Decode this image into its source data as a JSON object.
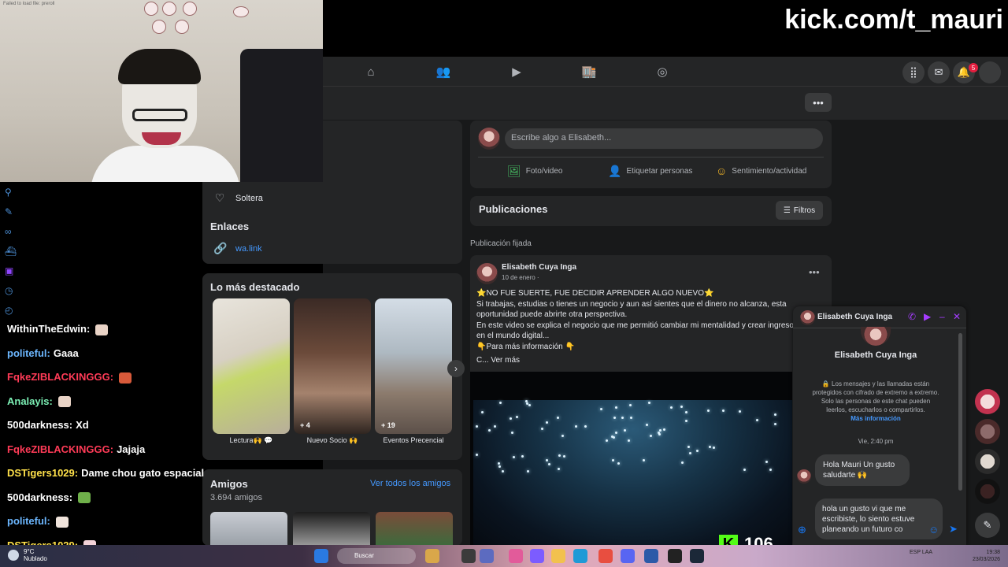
{
  "overlay": {
    "kick_url": "kick.com/t_mauri",
    "webcam_error": "Failed to load file: preroll",
    "viewer_count": "106",
    "chat": [
      {
        "user": "WithinTheEdwin:",
        "text": "",
        "color": "#ffffff"
      },
      {
        "user": "politeful:",
        "text": "Gaaa",
        "color": "#6cb7ff"
      },
      {
        "user": "FqkeZIBLACKINGGG:",
        "text": "",
        "color": "#ff3b57"
      },
      {
        "user": "Analayis:",
        "text": "",
        "color": "#7cf0b5"
      },
      {
        "user": "500darkness:",
        "text": "Xd",
        "color": "#ffffff"
      },
      {
        "user": "FqkeZIBLACKINGGG:",
        "text": "Jajaja",
        "color": "#ff3b57"
      },
      {
        "user": "DSTigers1029:",
        "text": "Dame chou gato espacial",
        "color": "#ffe14a"
      },
      {
        "user": "500darkness:",
        "text": "",
        "color": "#ffffff"
      },
      {
        "user": "politeful:",
        "text": "",
        "color": "#6cb7ff"
      },
      {
        "user": "DSTigers1029:",
        "text": "",
        "color": "#ffe14a"
      }
    ]
  },
  "profile": {
    "relationship": "Soltera",
    "links_title": "Enlaces",
    "link": "wa.link",
    "highlights_title": "Lo más destacado",
    "highlights": [
      {
        "label": "Lectura🙌 💬",
        "count": ""
      },
      {
        "label": "Nuevo Socio 🙌",
        "count": "+ 4"
      },
      {
        "label": "Eventos Precencial",
        "count": "+ 19"
      }
    ],
    "friends_title": "Amigos",
    "friends_count": "3.694 amigos",
    "see_all_friends": "Ver todos los amigos"
  },
  "composer": {
    "placeholder": "Escribe algo a Elisabeth...",
    "actions": [
      "Foto/video",
      "Etiquetar personas",
      "Sentimiento/actividad"
    ]
  },
  "posts": {
    "title": "Publicaciones",
    "filter": "Filtros",
    "pinned_label": "Publicación fijada",
    "post": {
      "author": "Elisabeth Cuya Inga",
      "date": "10 de enero ·",
      "line1": "⭐NO FUE SUERTE, FUE DECIDIR APRENDER ALGO NUEVO⭐",
      "line2": "Si trabajas, estudias o tienes un negocio y aun así sientes que el dinero no alcanza, esta oportunidad puede abrirte otra perspectiva.",
      "line3": "En este video se explica el negocio que me permitió cambiar mi mentalidad y crear ingresos en el mundo digital...",
      "line4": "👇Para más información 👇",
      "more": "C... Ver más"
    }
  },
  "messenger": {
    "contact_name": "Elisabeth Cuya Inga",
    "encryption": "🔒 Los mensajes y las llamadas están protegidos con cifrado de extremo a extremo. Solo las personas de este chat pueden leerlos, escucharlos o compartirlos.",
    "more_info": "Más información",
    "timestamp": "Vie, 2:40 pm",
    "received": "Hola Mauri Un gusto saludarte 🙌",
    "draft": "hola un gusto vi que me escribiste, lo siento estuve planeando un futuro co"
  },
  "taskbar": {
    "temp": "9°C",
    "weather": "Nublado",
    "search": "Buscar",
    "lang": "ESP LAA",
    "time": "19:38",
    "date": "23/03/2026"
  }
}
